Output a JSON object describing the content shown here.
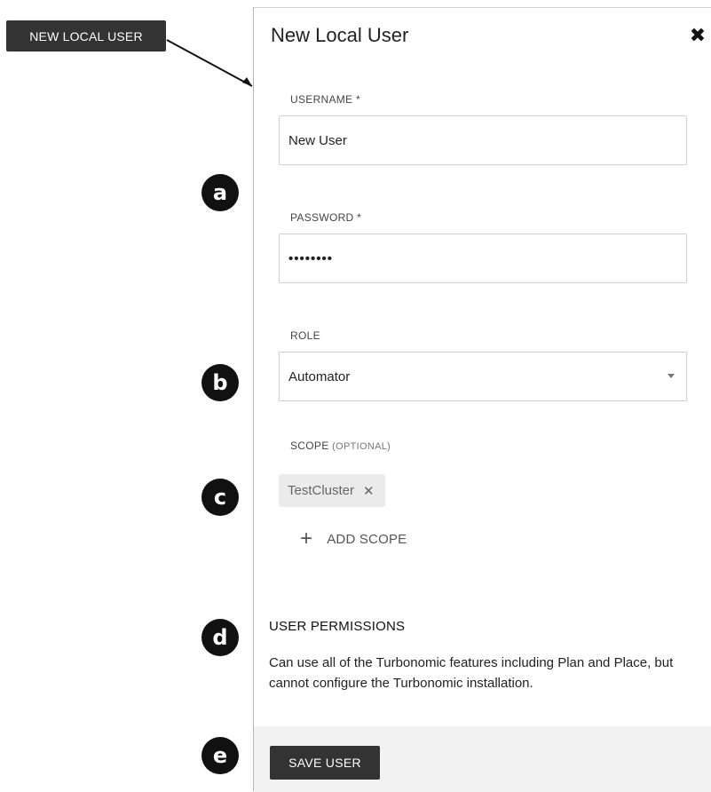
{
  "callout": {
    "label": "NEW LOCAL USER"
  },
  "dialog": {
    "title": "New Local User",
    "close_glyph": "✖",
    "username": {
      "label": "USERNAME *",
      "value": "New User"
    },
    "password": {
      "label": "PASSWORD *",
      "value": "••••••••"
    },
    "role": {
      "label": "ROLE",
      "value": "Automator"
    },
    "scope": {
      "label": "SCOPE",
      "label_optional": "(OPTIONAL)",
      "chips": [
        {
          "label": "TestCluster",
          "remove_glyph": "✕"
        }
      ],
      "add_glyph": "+",
      "add_label": "ADD SCOPE"
    },
    "permissions": {
      "title": "USER PERMISSIONS",
      "text": "Can use all of the Turbonomic features including Plan and Place, but cannot configure the Turbonomic installation."
    },
    "footer": {
      "save_label": "SAVE USER"
    }
  },
  "badges": [
    "a",
    "b",
    "c",
    "d",
    "e"
  ],
  "colors": {
    "dark": "#333333",
    "panel_border": "#b8b8b8",
    "footer_bg": "#f2f2f2",
    "chip_bg": "#ebebeb"
  }
}
